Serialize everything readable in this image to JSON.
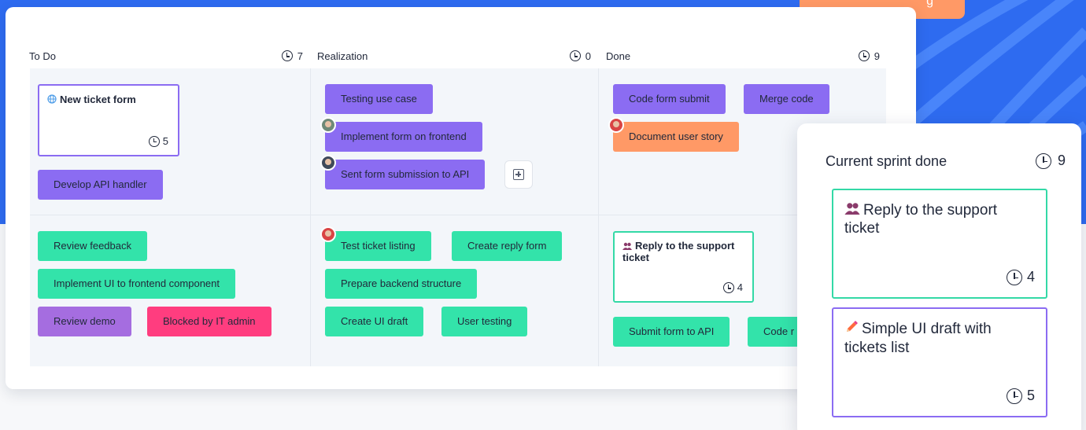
{
  "promo_tab": {
    "label": "g"
  },
  "columns": [
    {
      "title": "To Do",
      "count": "7"
    },
    {
      "title": "Realization",
      "count": "0"
    },
    {
      "title": "Done",
      "count": "9"
    }
  ],
  "lane1": {
    "todo_note": {
      "title": "New ticket form",
      "icon": "globe-icon",
      "estimate": "5"
    },
    "todo_card": "Develop API handler",
    "real_cards": [
      "Testing use case",
      "Implement form on frontend",
      "Sent form submission to API"
    ],
    "done_cards": [
      "Code form submit",
      "Merge code",
      "Document user story"
    ]
  },
  "lane2": {
    "todo_cards": [
      "Review feedback",
      "Implement UI to frontend component",
      "Review demo",
      "Blocked by IT admin"
    ],
    "real_cards": [
      "Test ticket listing",
      "Create reply form",
      "Prepare backend structure",
      "Create UI draft",
      "User testing"
    ],
    "done_note": {
      "title": "Reply to the support ticket",
      "icon": "users-icon",
      "estimate": "4"
    },
    "done_cards": [
      "Submit form to API",
      "Code r"
    ]
  },
  "panel": {
    "title": "Current sprint done",
    "count": "9",
    "cards": [
      {
        "title": "Reply to the support ticket",
        "icon": "users-icon",
        "estimate": "4",
        "border": "#33d9a6"
      },
      {
        "title": "Simple UI draft with tickets list",
        "icon": "pencil-icon",
        "estimate": "5",
        "border": "#8b6cf2"
      }
    ]
  },
  "colors": {
    "background": "#2e6bf0",
    "purple": "#8b6cf2",
    "green": "#33e3aa",
    "orange": "#ff9966",
    "violet": "#a56de0",
    "pink": "#ff3d7f"
  }
}
